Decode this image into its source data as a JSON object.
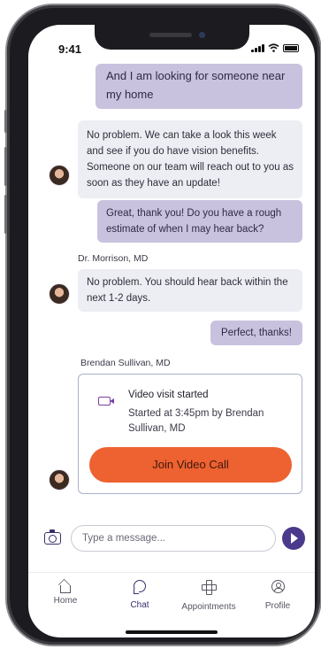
{
  "status_bar": {
    "time": "9:41"
  },
  "messages": [
    {
      "side": "out",
      "text": "And I am looking for someone near my home"
    },
    {
      "side": "in",
      "text": "No problem. We can take a look this week and see if you do have vision benefits. Someone on our team will reach out to you as soon as they have an update!"
    },
    {
      "side": "out",
      "text": "Great, thank you! Do you have a rough estimate of when I may hear back?"
    },
    {
      "side": "in",
      "sender": "Dr. Morrison, MD",
      "text": "No problem. You should hear back within the next 1-2 days."
    },
    {
      "side": "out",
      "text": "Perfect, thanks!"
    }
  ],
  "video_card": {
    "sender": "Brendan Sullivan, MD",
    "title": "Video visit started",
    "subtitle": "Started at 3:45pm by Brendan Sullivan, MD",
    "button_label": "Join Video Call",
    "button_color": "#ee6130"
  },
  "composer": {
    "placeholder": "Type a message...",
    "accent": "#4b3a8c"
  },
  "tabs": [
    {
      "label": "Home",
      "icon": "home-icon"
    },
    {
      "label": "Chat",
      "icon": "chat-icon",
      "active": true
    },
    {
      "label": "Appointments",
      "icon": "cross-icon"
    },
    {
      "label": "Profile",
      "icon": "profile-icon"
    }
  ]
}
